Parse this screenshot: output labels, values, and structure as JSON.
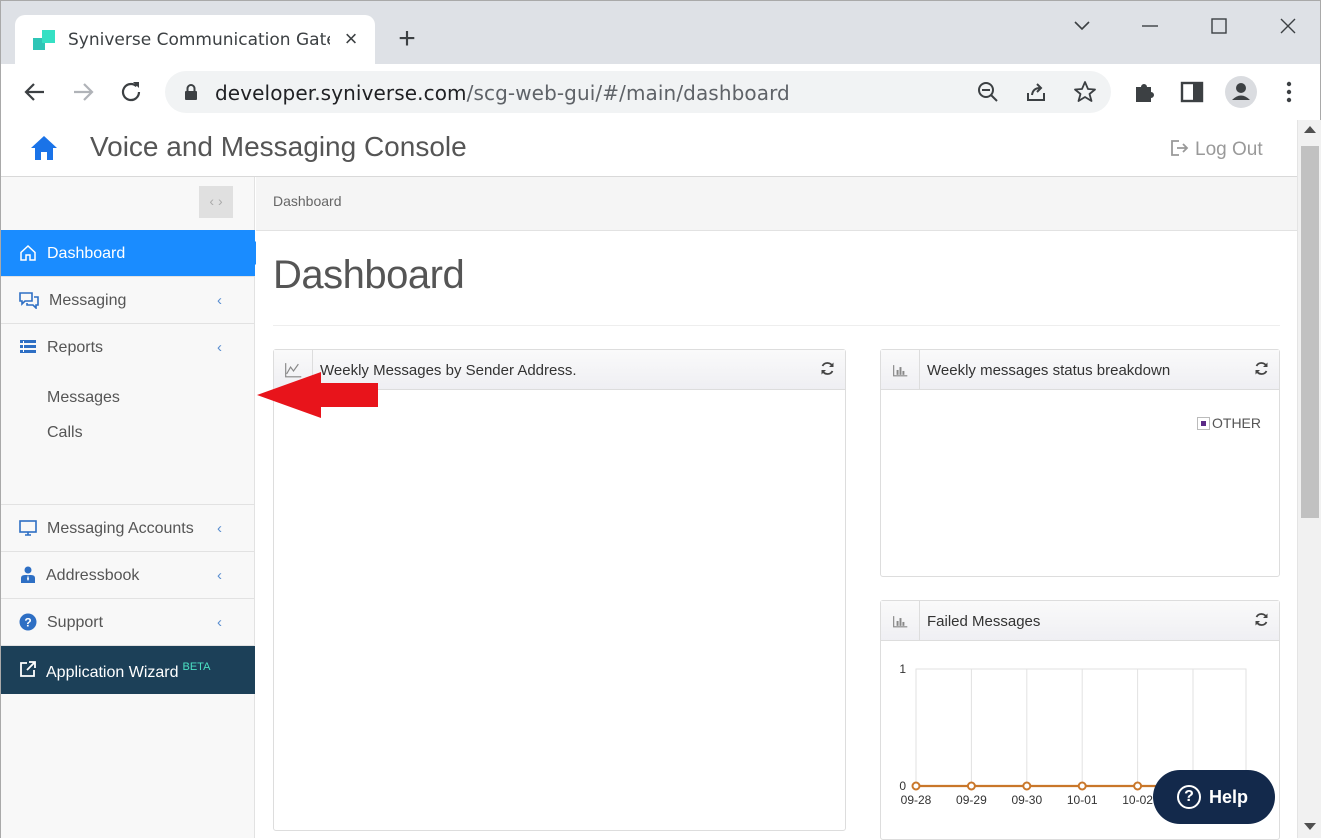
{
  "browser": {
    "tab_title": "Syniverse Communication Gatew",
    "tab_close": "×",
    "new_tab": "+",
    "url_host": "developer.syniverse.com",
    "url_path": "/scg-web-gui/#/main/dashboard"
  },
  "header": {
    "title": "Voice and Messaging Console",
    "logout": "Log Out"
  },
  "sidebar": {
    "collapse": "‹ ›",
    "items": [
      {
        "label": "Dashboard",
        "icon": "home-outline-icon"
      },
      {
        "label": "Messaging",
        "icon": "chat-icon",
        "chevron": "‹"
      },
      {
        "label": "Reports",
        "icon": "list-icon",
        "chevron": "‹"
      },
      {
        "label": "Messaging Accounts",
        "icon": "monitor-icon",
        "chevron": "‹"
      },
      {
        "label": "Addressbook",
        "icon": "user-icon",
        "chevron": "‹"
      },
      {
        "label": "Support",
        "icon": "question-icon",
        "chevron": "‹"
      }
    ],
    "reports_sub": [
      "Messages",
      "Calls"
    ],
    "wizard": {
      "label": "Application Wizard",
      "badge": "BETA"
    }
  },
  "main": {
    "breadcrumb": "Dashboard",
    "title": "Dashboard",
    "widgets": {
      "sender": {
        "title": "Weekly Messages by Sender Address."
      },
      "status": {
        "title": "Weekly messages status breakdown",
        "legend": "OTHER"
      },
      "failed": {
        "title": "Failed Messages"
      }
    }
  },
  "chart_data": {
    "type": "line",
    "title": "Failed Messages",
    "categories": [
      "09-28",
      "09-29",
      "09-30",
      "10-01",
      "10-02"
    ],
    "series": [
      {
        "values": [
          0,
          0,
          0,
          0,
          0
        ]
      }
    ],
    "ylim": [
      0,
      1
    ],
    "yticks": [
      "0",
      "1"
    ],
    "grid": true,
    "colors": {
      "line": "#c9772a"
    }
  },
  "help": {
    "label": "Help",
    "icon_glyph": "?"
  }
}
